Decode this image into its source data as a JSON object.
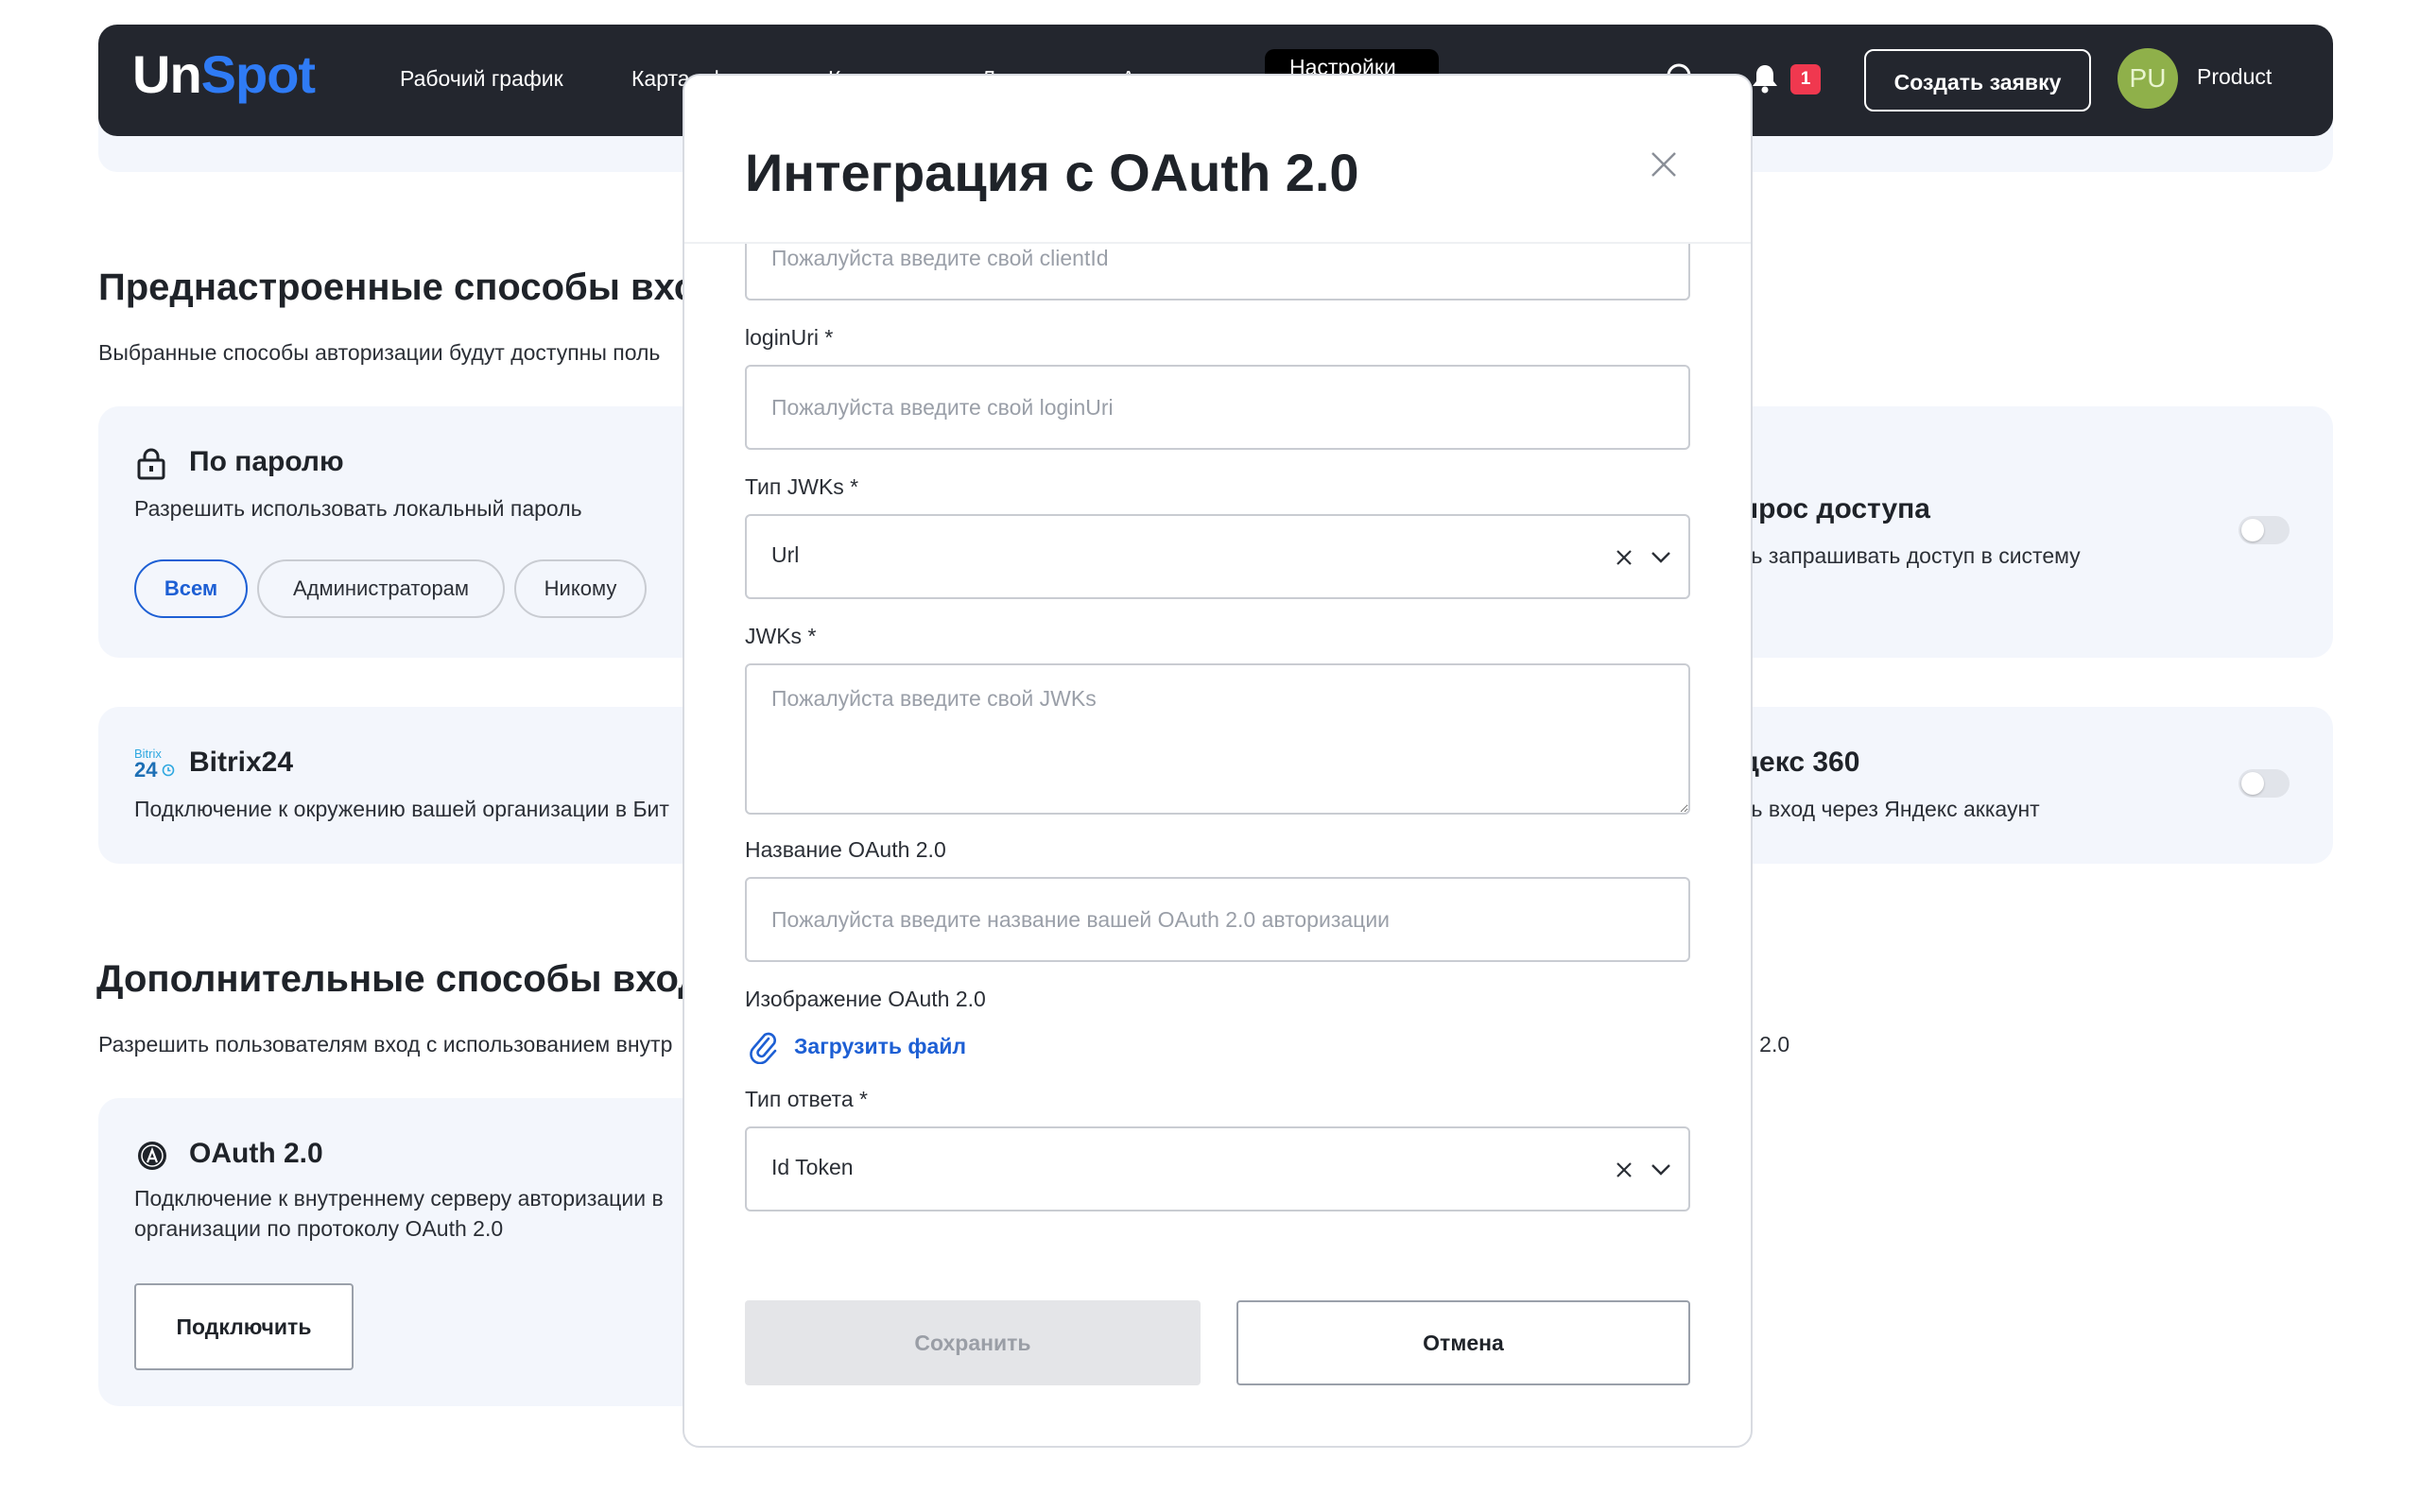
{
  "app": {
    "logo_un": "Un",
    "logo_spot": "Spot"
  },
  "header": {
    "nav": [
      "Рабочий график",
      "Карта офиса",
      "К",
      "Л",
      "А",
      "Настройки"
    ],
    "notifications_count": "1",
    "create_button": "Создать заявку",
    "avatar_initials": "PU",
    "user_name": "Product"
  },
  "page": {
    "preset_title": "Преднастроенные способы вхо",
    "preset_sub": "Выбранные способы авторизации будут доступны поль",
    "password_card": {
      "title": "По паролю",
      "text": "Разрешить использовать локальный пароль",
      "options": [
        "Всем",
        "Администраторам",
        "Никому"
      ],
      "selected": "Всем"
    },
    "access_card": {
      "title": "прос доступа",
      "text": "ть запрашивать доступ в систему"
    },
    "bitrix_card": {
      "logo_top": "Bitrix",
      "logo_num": "24",
      "title": "Bitrix24",
      "text": "Подключение к окружению вашей организации в Бит"
    },
    "yandex_card": {
      "title": "декс 360",
      "text": "ть вход через Яндекс аккаунт"
    },
    "extra_title": "Дополнительные способы вход",
    "extra_sub": "Разрешить пользователям вход с использованием внутр",
    "extra_sub_right": "h 2.0",
    "oauth_card": {
      "title": "OAuth 2.0",
      "text_line1": "Подключение к внутреннему серверу авторизации в",
      "text_line2": "организации по протоколу OAuth 2.0",
      "connect_button": "Подключить"
    }
  },
  "modal": {
    "title": "Интеграция с OAuth 2.0",
    "client_id_placeholder": "Пожалуйста введите свой clientId",
    "login_uri_label": "loginUri *",
    "login_uri_placeholder": "Пожалуйста введите свой loginUri",
    "jwks_type_label": "Тип JWKs *",
    "jwks_type_value": "Url",
    "jwks_label": "JWKs *",
    "jwks_placeholder": "Пожалуйста введите свой JWKs",
    "name_label": "Название OAuth 2.0",
    "name_placeholder": "Пожалуйста введите название вашей OAuth 2.0 авторизации",
    "image_label": "Изображение OAuth 2.0",
    "upload_label": "Загрузить файл",
    "response_type_label": "Тип ответа *",
    "response_type_value": "Id Token",
    "save_button": "Сохранить",
    "cancel_button": "Отмена"
  },
  "colors": {
    "header_bg": "#23262e",
    "accent": "#1d5fd4",
    "logo_spot": "#2f7bf5",
    "badge": "#f0384f",
    "card_bg": "#f3f6fc"
  }
}
